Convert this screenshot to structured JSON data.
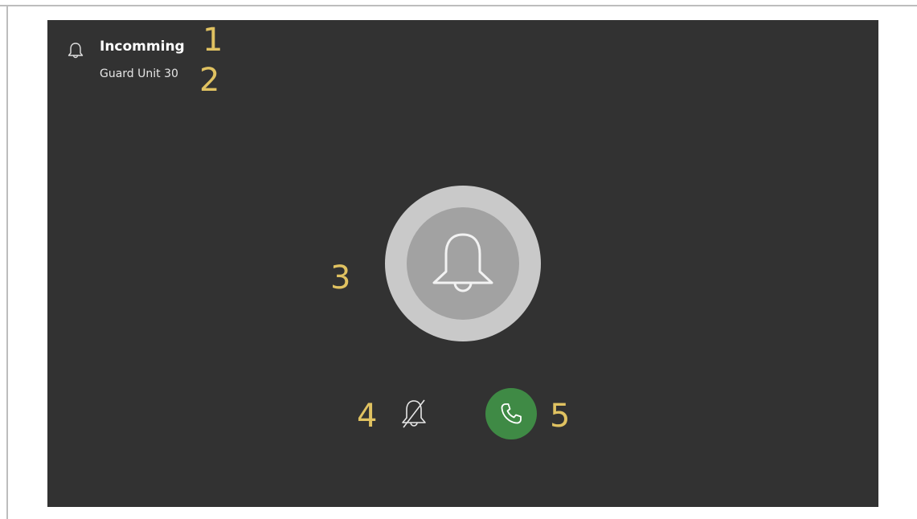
{
  "call": {
    "status": "Incomming",
    "caller": "Guard Unit 30"
  },
  "callouts": [
    "1",
    "2",
    "3",
    "4",
    "5"
  ],
  "icons": {
    "header": "bell-icon",
    "center": "bell-icon",
    "mute": "bell-off-icon",
    "accept": "phone-icon"
  },
  "colors": {
    "screen_background": "#323232",
    "accept": "#3f8a45",
    "callout": "#e0c261",
    "ring_outer": "#c9c9c9",
    "ring_inner": "#a2a2a2"
  }
}
